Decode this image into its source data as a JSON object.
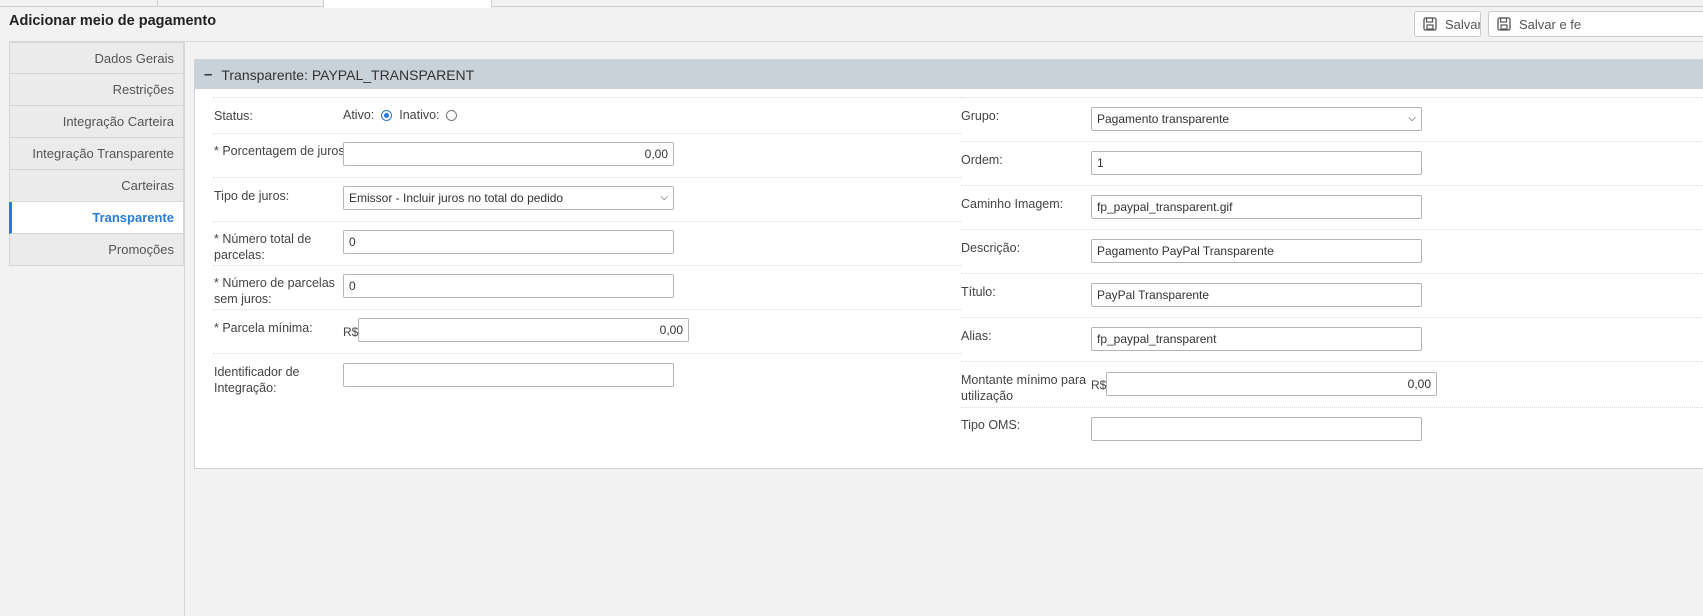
{
  "page": {
    "title": "Adicionar meio de pagamento"
  },
  "toolbar": {
    "save_label": "Salvar",
    "save_close_label": "Salvar e fe"
  },
  "sidebar": {
    "items": [
      {
        "label": "Dados Gerais"
      },
      {
        "label": "Restrições"
      },
      {
        "label": "Integração Carteira"
      },
      {
        "label": "Integração Transparente"
      },
      {
        "label": "Carteiras"
      },
      {
        "label": "Transparente",
        "active": true
      },
      {
        "label": "Promoções"
      }
    ]
  },
  "panel": {
    "toggle": "–",
    "title": "Transparente: PAYPAL_TRANSPARENT",
    "left": {
      "status": {
        "label": "Status:",
        "ativo": "Ativo:",
        "inativo": "Inativo:",
        "selected": "Ativo"
      },
      "juros_pct": {
        "label": "* Porcentagem de juros:",
        "value": "0,00"
      },
      "tipo_juros": {
        "label": "Tipo de juros:",
        "value": "Emissor - Incluir juros no total do pedido"
      },
      "num_parcelas": {
        "label1": "* Número total de",
        "label2": "parcelas:",
        "value": "0"
      },
      "num_parcelas_sem_juros": {
        "label1": "* Número de parcelas",
        "label2": "sem juros:",
        "value": "0"
      },
      "parcela_minima": {
        "label": "* Parcela mínima:",
        "currency": "R$",
        "value": "0,00"
      },
      "identificador": {
        "label1": "Identificador de",
        "label2": "Integração:",
        "value": ""
      }
    },
    "right": {
      "grupo": {
        "label": "Grupo:",
        "value": "Pagamento transparente"
      },
      "ordem": {
        "label": "Ordem:",
        "value": "1"
      },
      "caminho": {
        "label": "Caminho Imagem:",
        "value": "fp_paypal_transparent.gif"
      },
      "descricao": {
        "label": "Descrição:",
        "value": "Pagamento PayPal Transparente"
      },
      "titulo": {
        "label": "Título:",
        "value": "PayPal Transparente"
      },
      "alias": {
        "label": "Alias:",
        "value": "fp_paypal_transparent"
      },
      "montante": {
        "label1": "Montante mínimo para",
        "label2": "utilização",
        "currency": "R$",
        "value": "0,00"
      },
      "tipo_oms": {
        "label": "Tipo OMS:",
        "value": ""
      }
    }
  },
  "colors": {
    "accent": "#2a7ad6",
    "panel_header": "#c9d1d9",
    "background": "#f2f2f2"
  }
}
